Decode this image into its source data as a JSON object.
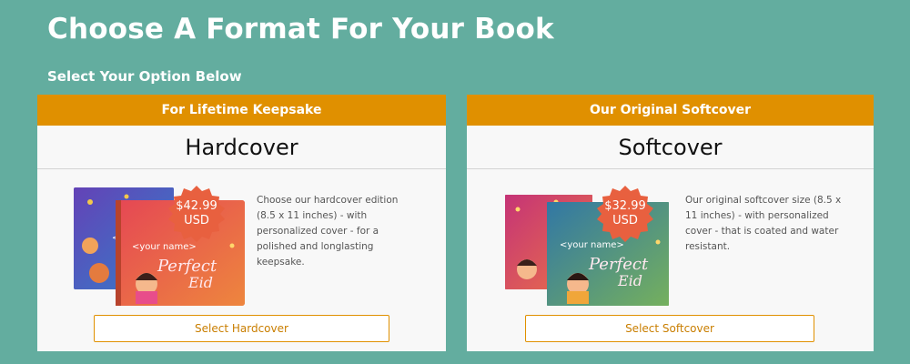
{
  "header": {
    "title": "Choose A Format For Your Book",
    "subtitle": "Select Your Option Below"
  },
  "colors": {
    "background": "#63ad9f",
    "accent": "#e09000",
    "badge": "#e8603f"
  },
  "options": [
    {
      "banner": "For Lifetime Keepsake",
      "title": "Hardcover",
      "price": "$42.99",
      "currency": "USD",
      "description": "Choose our hardcover edition (8.5 x 11 inches) - with personalized cover - for a polished and longlasting keepsake.",
      "cover_name": "<your name>",
      "cover_title": "Perfect Eid",
      "button": "Select Hardcover"
    },
    {
      "banner": "Our Original Softcover",
      "title": "Softcover",
      "price": "$32.99",
      "currency": "USD",
      "description": "Our original softcover size (8.5 x 11 inches) - with personalized cover - that is coated and water resistant.",
      "cover_name": "<your name>",
      "cover_title": "Perfect Eid",
      "button": "Select Softcover"
    }
  ]
}
